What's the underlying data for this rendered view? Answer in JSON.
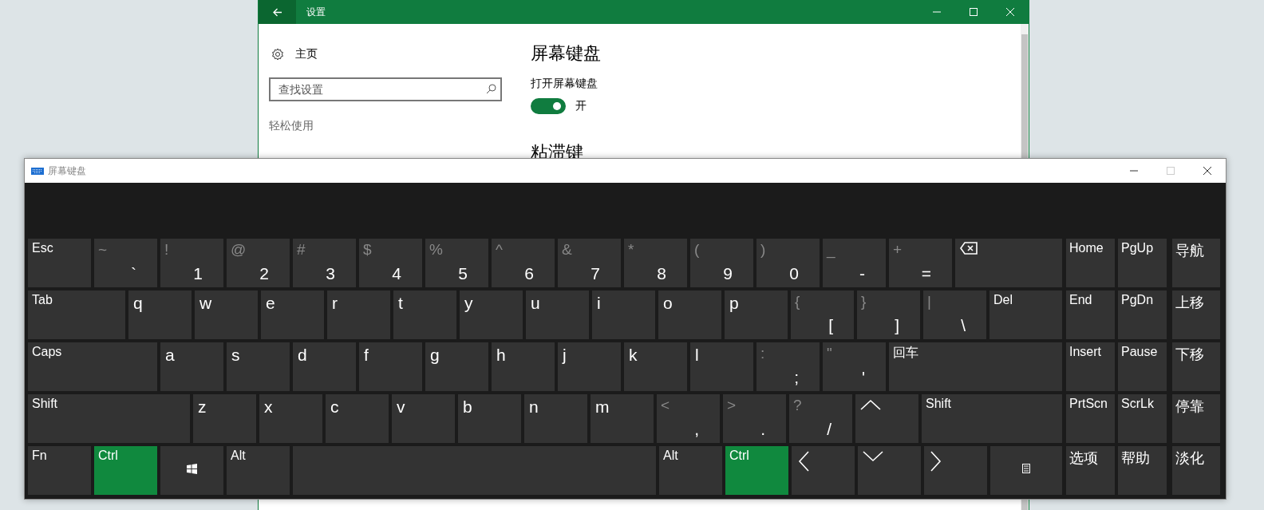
{
  "settings_window": {
    "title": "设置",
    "sidebar": {
      "home": "主页",
      "search": {
        "placeholder": "查找设置"
      },
      "section": "轻松使用"
    },
    "main": {
      "heading": "屏幕键盘",
      "setting_label": "打开屏幕键盘",
      "toggle": {
        "on": true,
        "text": "开"
      },
      "next_heading": "粘滞键"
    }
  },
  "keyboard_window": {
    "title": "屏幕键盘",
    "rows": [
      {
        "keys": [
          {
            "kind": "word",
            "label": "Esc",
            "on": false
          },
          {
            "kind": "dual",
            "shift": "~",
            "label": "`",
            "on": false
          },
          {
            "kind": "dual",
            "shift": "!",
            "label": "1",
            "on": false
          },
          {
            "kind": "dual",
            "shift": "@",
            "label": "2",
            "on": false
          },
          {
            "kind": "dual",
            "shift": "#",
            "label": "3",
            "on": false
          },
          {
            "kind": "dual",
            "shift": "$",
            "label": "4",
            "on": false
          },
          {
            "kind": "dual",
            "shift": "%",
            "label": "5",
            "on": false
          },
          {
            "kind": "dual",
            "shift": "^",
            "label": "6",
            "on": false
          },
          {
            "kind": "dual",
            "shift": "&",
            "label": "7",
            "on": false
          },
          {
            "kind": "dual",
            "shift": "*",
            "label": "8",
            "on": false
          },
          {
            "kind": "dual",
            "shift": "(",
            "label": "9",
            "on": false
          },
          {
            "kind": "dual",
            "shift": ")",
            "label": "0",
            "on": false
          },
          {
            "kind": "dual",
            "shift": "_",
            "label": "-",
            "on": false
          },
          {
            "kind": "dual",
            "shift": "+",
            "label": "=",
            "on": false
          },
          {
            "kind": "backspace",
            "on": false
          }
        ]
      },
      {
        "keys": [
          {
            "kind": "word",
            "label": "Tab",
            "on": false
          },
          {
            "kind": "letter",
            "label": "q",
            "on": false
          },
          {
            "kind": "letter",
            "label": "w",
            "on": false
          },
          {
            "kind": "letter",
            "label": "e",
            "on": false
          },
          {
            "kind": "letter",
            "label": "r",
            "on": false
          },
          {
            "kind": "letter",
            "label": "t",
            "on": false
          },
          {
            "kind": "letter",
            "label": "y",
            "on": false
          },
          {
            "kind": "letter",
            "label": "u",
            "on": false
          },
          {
            "kind": "letter",
            "label": "i",
            "on": false
          },
          {
            "kind": "letter",
            "label": "o",
            "on": false
          },
          {
            "kind": "letter",
            "label": "p",
            "on": false
          },
          {
            "kind": "dual",
            "shift": "{",
            "label": "[",
            "on": false
          },
          {
            "kind": "dual",
            "shift": "}",
            "label": "]",
            "on": false
          },
          {
            "kind": "dual",
            "shift": "|",
            "label": "\\",
            "on": false
          },
          {
            "kind": "word",
            "label": "Del",
            "on": false
          }
        ]
      },
      {
        "keys": [
          {
            "kind": "word",
            "label": "Caps",
            "on": false
          },
          {
            "kind": "letter",
            "label": "a",
            "on": false
          },
          {
            "kind": "letter",
            "label": "s",
            "on": false
          },
          {
            "kind": "letter",
            "label": "d",
            "on": false
          },
          {
            "kind": "letter",
            "label": "f",
            "on": false
          },
          {
            "kind": "letter",
            "label": "g",
            "on": false
          },
          {
            "kind": "letter",
            "label": "h",
            "on": false
          },
          {
            "kind": "letter",
            "label": "j",
            "on": false
          },
          {
            "kind": "letter",
            "label": "k",
            "on": false
          },
          {
            "kind": "letter",
            "label": "l",
            "on": false
          },
          {
            "kind": "dual",
            "shift": ":",
            "label": ";",
            "on": false
          },
          {
            "kind": "dual",
            "shift": "\"",
            "label": "'",
            "on": false
          },
          {
            "kind": "word",
            "label": "回车",
            "on": false
          }
        ]
      },
      {
        "keys": [
          {
            "kind": "word",
            "label": "Shift",
            "on": false
          },
          {
            "kind": "letter",
            "label": "z",
            "on": false
          },
          {
            "kind": "letter",
            "label": "x",
            "on": false
          },
          {
            "kind": "letter",
            "label": "c",
            "on": false
          },
          {
            "kind": "letter",
            "label": "v",
            "on": false
          },
          {
            "kind": "letter",
            "label": "b",
            "on": false
          },
          {
            "kind": "letter",
            "label": "n",
            "on": false
          },
          {
            "kind": "letter",
            "label": "m",
            "on": false
          },
          {
            "kind": "dual",
            "shift": "<",
            "label": ",",
            "on": false
          },
          {
            "kind": "dual",
            "shift": ">",
            "label": ".",
            "on": false
          },
          {
            "kind": "dual",
            "shift": "?",
            "label": "/",
            "on": false
          },
          {
            "kind": "up",
            "on": false
          },
          {
            "kind": "word",
            "label": "Shift",
            "on": false
          }
        ]
      },
      {
        "keys": [
          {
            "kind": "word",
            "label": "Fn",
            "on": false
          },
          {
            "kind": "word",
            "label": "Ctrl",
            "on": true
          },
          {
            "kind": "windows",
            "on": false
          },
          {
            "kind": "word",
            "label": "Alt",
            "on": false
          },
          {
            "kind": "space",
            "on": false
          },
          {
            "kind": "word",
            "label": "Alt",
            "on": false
          },
          {
            "kind": "word",
            "label": "Ctrl",
            "on": true
          },
          {
            "kind": "left",
            "on": false
          },
          {
            "kind": "down",
            "on": false
          },
          {
            "kind": "right",
            "on": false
          },
          {
            "kind": "menu",
            "on": false
          }
        ]
      }
    ],
    "side_keys": [
      [
        "Home",
        "PgUp",
        "导航"
      ],
      [
        "End",
        "PgDn",
        "上移"
      ],
      [
        "Insert",
        "Pause",
        "下移"
      ],
      [
        "PrtScn",
        "ScrLk",
        "停靠"
      ],
      [
        "选项",
        "帮助",
        "淡化"
      ]
    ]
  }
}
